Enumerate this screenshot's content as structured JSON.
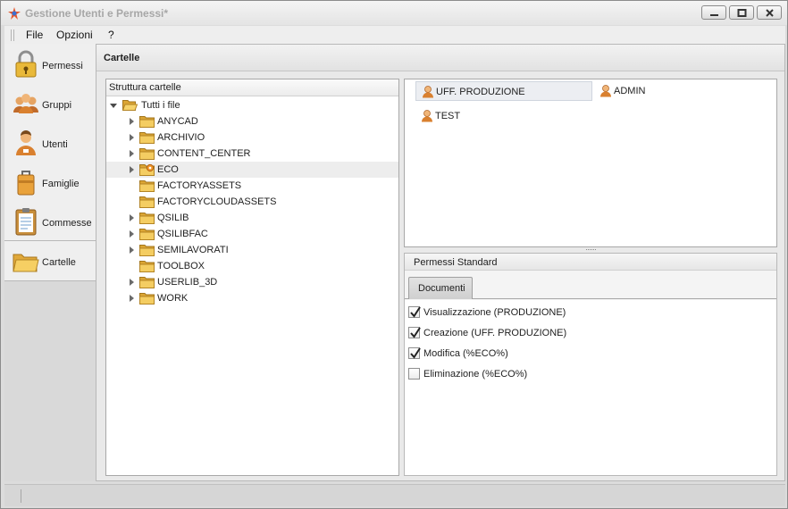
{
  "window": {
    "title": "Gestione Utenti e Permessi*",
    "buttons": [
      "minimize-icon",
      "maximize-icon",
      "close-icon"
    ]
  },
  "menu": {
    "items": [
      "File",
      "Opzioni",
      "?"
    ]
  },
  "nav": {
    "items": [
      {
        "label": "Permessi",
        "icon": "lock-icon"
      },
      {
        "label": "Gruppi",
        "icon": "group-icon"
      },
      {
        "label": "Utenti",
        "icon": "user-icon"
      },
      {
        "label": "Famiglie",
        "icon": "briefcase-icon"
      },
      {
        "label": "Commesse",
        "icon": "clipboard-icon"
      },
      {
        "label": "Cartelle",
        "icon": "folder-icon",
        "selected": true
      }
    ]
  },
  "main": {
    "title": "Cartelle"
  },
  "tree": {
    "header": "Struttura cartelle",
    "root": "Tutti i file",
    "items": [
      {
        "label": "ANYCAD",
        "expandable": true
      },
      {
        "label": "ARCHIVIO",
        "expandable": true
      },
      {
        "label": "CONTENT_CENTER",
        "expandable": true
      },
      {
        "label": "ECO",
        "expandable": true,
        "highlighted": true,
        "special_icon": "folder-gear-icon"
      },
      {
        "label": "FACTORYASSETS",
        "expandable": false
      },
      {
        "label": "FACTORYCLOUDASSETS",
        "expandable": false
      },
      {
        "label": "QSILIB",
        "expandable": true
      },
      {
        "label": "QSILIBFAC",
        "expandable": true
      },
      {
        "label": "SEMILAVORATI",
        "expandable": true
      },
      {
        "label": "TOOLBOX",
        "expandable": false
      },
      {
        "label": "USERLIB_3D",
        "expandable": true
      },
      {
        "label": "WORK",
        "expandable": true
      }
    ]
  },
  "users": {
    "items": [
      {
        "label": "UFF. PRODUZIONE",
        "selected": true
      },
      {
        "label": "ADMIN",
        "selected": false
      },
      {
        "label": "TEST",
        "selected": false
      }
    ]
  },
  "permissions": {
    "header": "Permessi Standard",
    "tab": "Documenti",
    "items": [
      {
        "label": "Visualizzazione (PRODUZIONE)",
        "checked": true
      },
      {
        "label": "Creazione (UFF. PRODUZIONE)",
        "checked": true
      },
      {
        "label": "Modifica (%ECO%)",
        "checked": true
      },
      {
        "label": "Eliminazione (%ECO%)",
        "checked": false
      }
    ]
  },
  "colors": {
    "accent_folder": "#f0c24a",
    "user_icon": "#d98b2b",
    "window_bg": "#dcdcdc"
  }
}
